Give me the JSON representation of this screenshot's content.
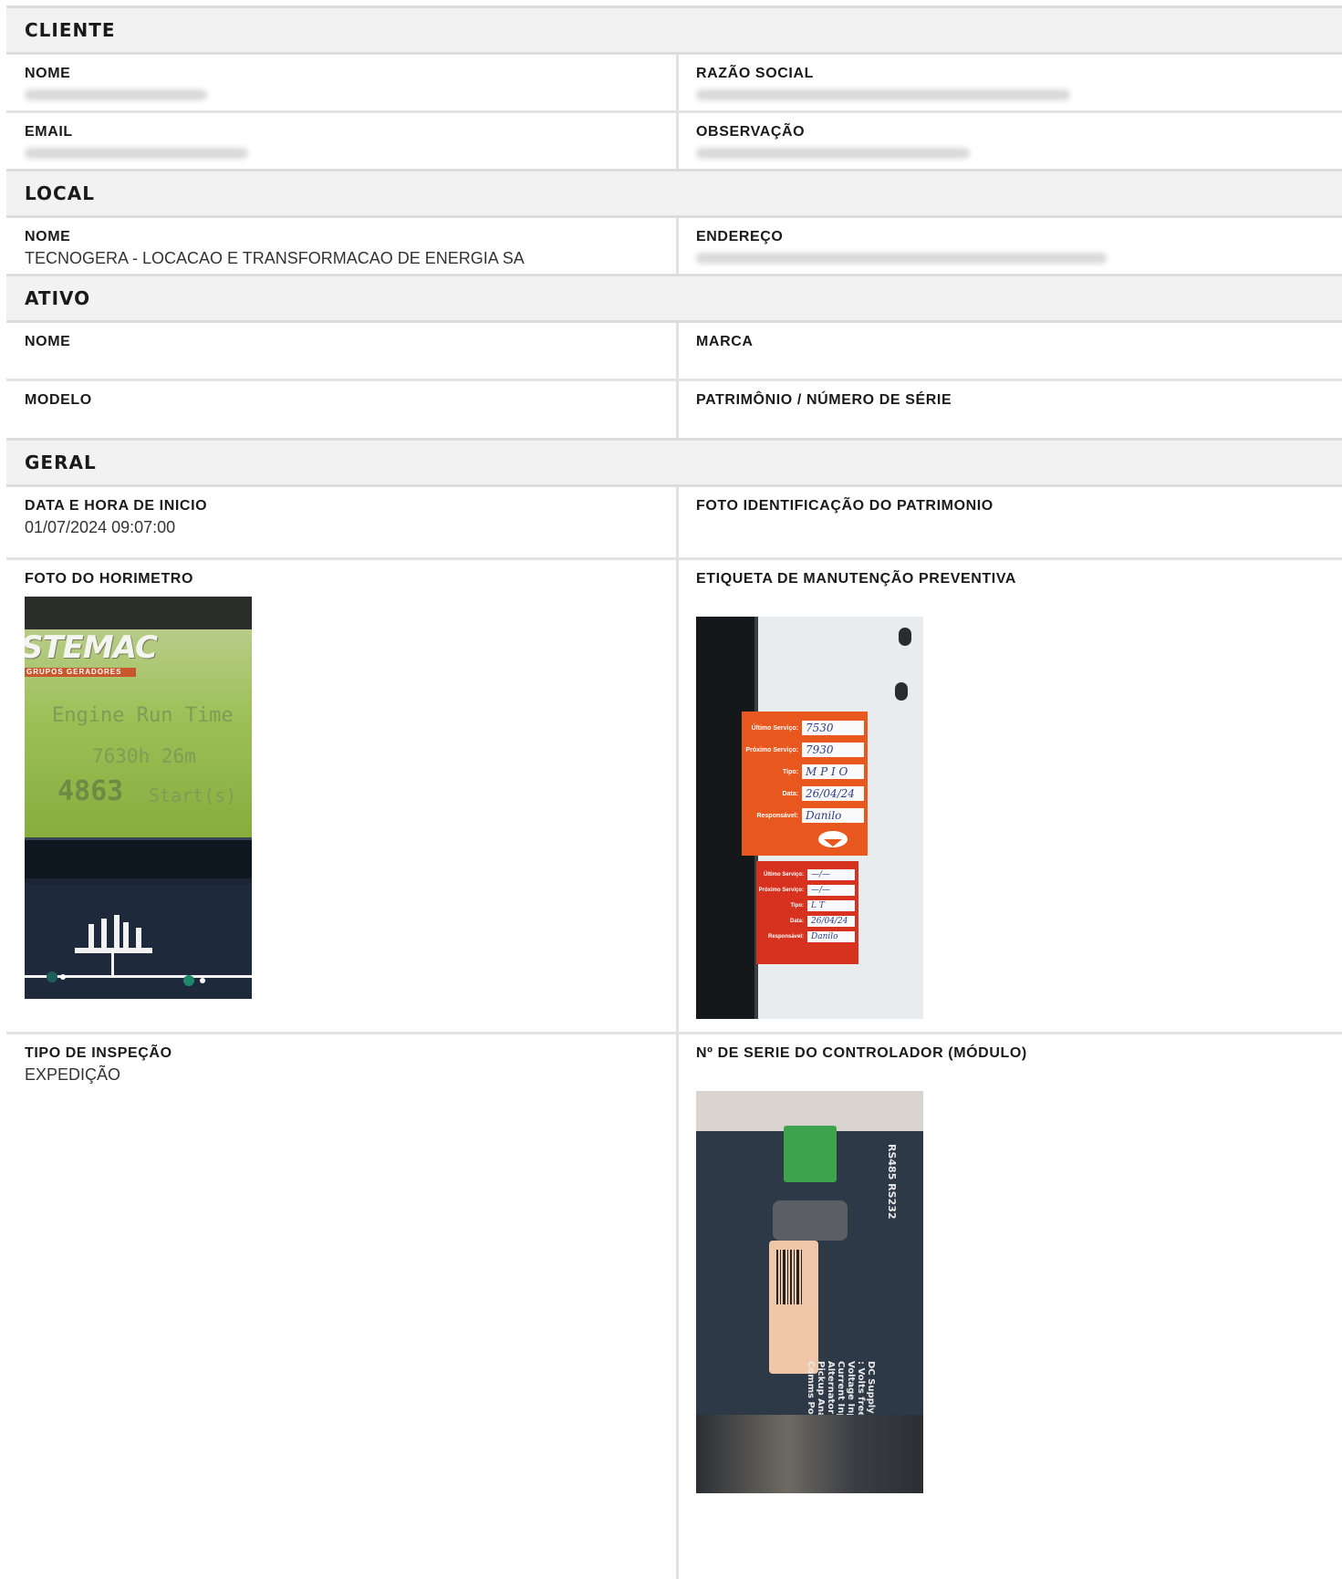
{
  "cliente": {
    "section_title": "CLIENTE",
    "nome_label": "NOME",
    "razao_label": "RAZÃO SOCIAL",
    "email_label": "EMAIL",
    "obs_label": "OBSERVAÇÃO"
  },
  "local": {
    "section_title": "LOCAL",
    "nome_label": "NOME",
    "nome_value": "TECNOGERA - LOCACAO E TRANSFORMACAO DE ENERGIA SA",
    "endereco_label": "ENDEREÇO"
  },
  "ativo": {
    "section_title": "ATIVO",
    "nome_label": "NOME",
    "marca_label": "MARCA",
    "modelo_label": "MODELO",
    "patrimonio_label": "PATRIMÔNIO / NÚMERO DE SÉRIE"
  },
  "geral": {
    "section_title": "GERAL",
    "data_label": "DATA E HORA DE INICIO",
    "data_value": "01/07/2024 09:07:00",
    "foto_patrimonio_label": "FOTO IDENTIFICAÇÃO DO PATRIMONIO",
    "foto_horimetro_label": "FOTO DO HORIMETRO",
    "etiqueta_label": "ETIQUETA DE MANUTENÇÃO PREVENTIVA",
    "tipo_label": "TIPO DE INSPEÇÃO",
    "tipo_value": "EXPEDIÇÃO",
    "serie_label": "Nº DE SERIE DO CONTROLADOR (MÓDULO)"
  },
  "photos": {
    "horimetro": {
      "logo": "STEMAC",
      "logo_sub": "GRUPOS GERADORES",
      "line1": "Engine Run Time",
      "line2": "7630h 26m",
      "line3": "4863",
      "line3b": "Start(s)"
    },
    "etiqueta": {
      "tag1": [
        {
          "k": "Último Serviço:",
          "v": "7530"
        },
        {
          "k": "Próximo Serviço:",
          "v": "7930"
        },
        {
          "k": "Tipo:",
          "v": "M P I O"
        },
        {
          "k": "Data:",
          "v": "26/04/24"
        },
        {
          "k": "Responsável:",
          "v": "Danilo"
        }
      ],
      "tag2": [
        {
          "k": "Último Serviço:",
          "v": "—/—"
        },
        {
          "k": "Próximo Serviço:",
          "v": "—/—"
        },
        {
          "k": "Tipo:",
          "v": "L T"
        },
        {
          "k": "Data:",
          "v": "26/04/24"
        },
        {
          "k": "Responsável:",
          "v": "Danilo"
        }
      ]
    },
    "controlador": {
      "port_label": "RS485  RS232",
      "specs": "DC Supply : DC Outputs : Volts free Outputs AC Voltage Inputs AC Current Inputs Charge Alternator Magnetic Pickup Analog Inputs Comms Port"
    }
  },
  "colors": {
    "section_bg": "#f2f2f2",
    "border": "#e2e2e2"
  }
}
